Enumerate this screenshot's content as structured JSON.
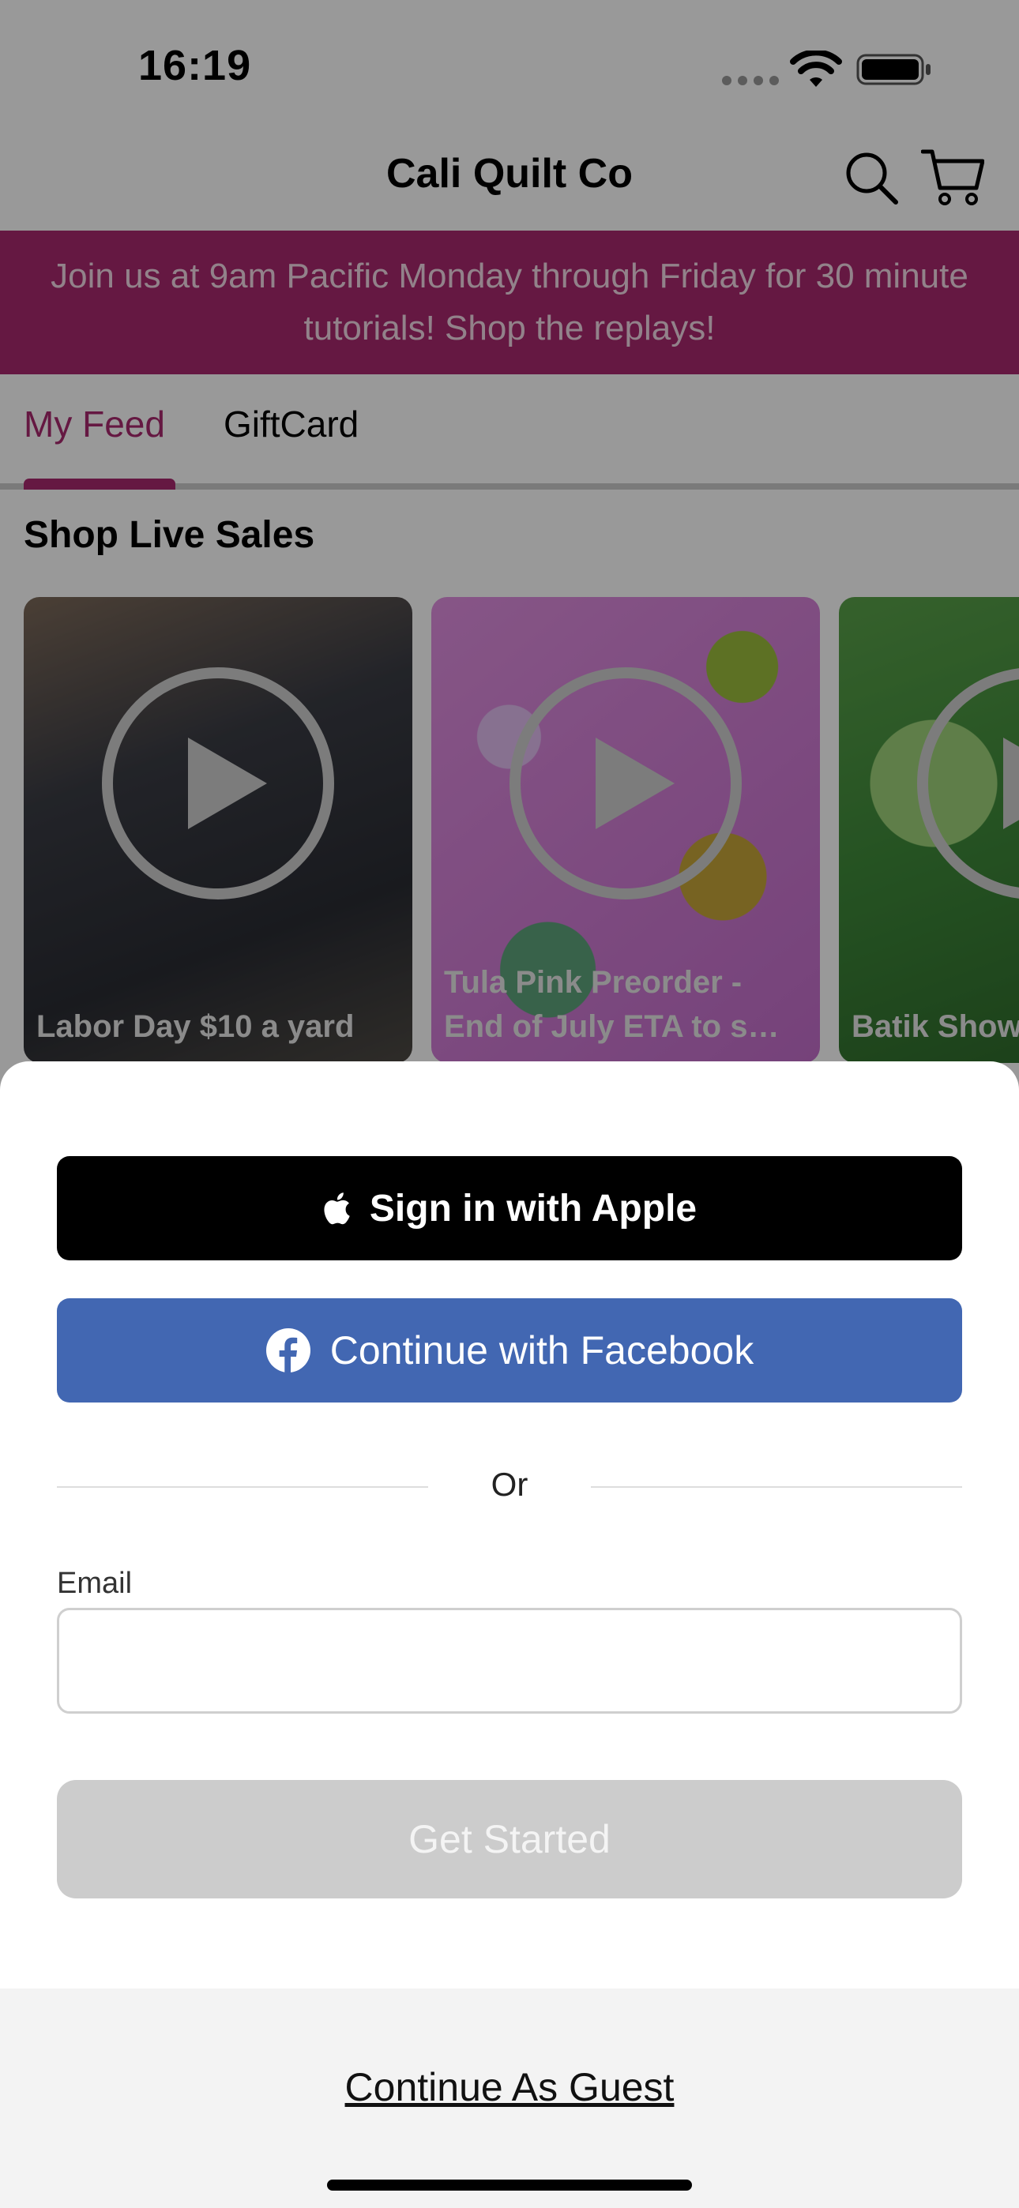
{
  "status_bar": {
    "time": "16:19"
  },
  "header": {
    "title": "Cali Quilt Co"
  },
  "banner": {
    "text": "Join us at 9am Pacific Monday through Friday for 30 minute tutorials!  Shop the replays!"
  },
  "tabs": [
    {
      "label": "My Feed",
      "active": true
    },
    {
      "label": "GiftCard",
      "active": false
    }
  ],
  "section": {
    "title": "Shop Live Sales"
  },
  "cards": [
    {
      "label": "Labor Day $10 a yard"
    },
    {
      "label": "Tula Pink Preorder - End of July ETA to s…"
    },
    {
      "label": "Batik Show"
    }
  ],
  "sheet": {
    "apple_button": "Sign in with Apple",
    "facebook_button": "Continue with Facebook",
    "or_text": "Or",
    "email_label": "Email",
    "email_value": "",
    "get_started": "Get Started",
    "guest_link": "Continue As Guest"
  },
  "colors": {
    "brand": "#a8296e",
    "facebook": "#4267b2",
    "apple": "#000000",
    "disabled_button": "#cccccc"
  }
}
